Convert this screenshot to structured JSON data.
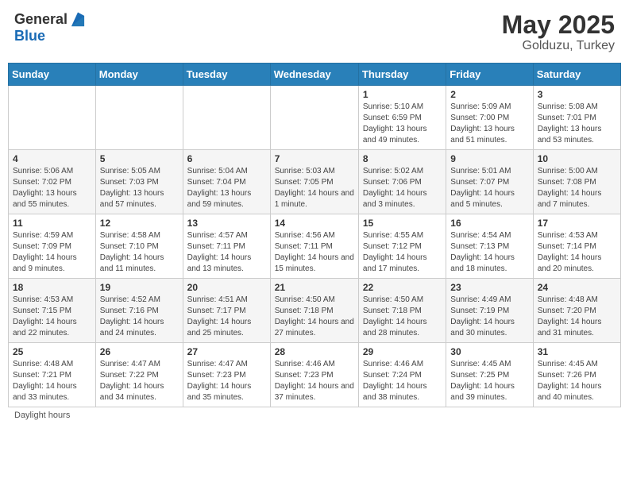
{
  "header": {
    "logo_general": "General",
    "logo_blue": "Blue",
    "month_year": "May 2025",
    "location": "Golduzu, Turkey"
  },
  "columns": [
    "Sunday",
    "Monday",
    "Tuesday",
    "Wednesday",
    "Thursday",
    "Friday",
    "Saturday"
  ],
  "weeks": [
    [
      {
        "day": "",
        "info": ""
      },
      {
        "day": "",
        "info": ""
      },
      {
        "day": "",
        "info": ""
      },
      {
        "day": "",
        "info": ""
      },
      {
        "day": "1",
        "info": "Sunrise: 5:10 AM\nSunset: 6:59 PM\nDaylight: 13 hours and 49 minutes."
      },
      {
        "day": "2",
        "info": "Sunrise: 5:09 AM\nSunset: 7:00 PM\nDaylight: 13 hours and 51 minutes."
      },
      {
        "day": "3",
        "info": "Sunrise: 5:08 AM\nSunset: 7:01 PM\nDaylight: 13 hours and 53 minutes."
      }
    ],
    [
      {
        "day": "4",
        "info": "Sunrise: 5:06 AM\nSunset: 7:02 PM\nDaylight: 13 hours and 55 minutes."
      },
      {
        "day": "5",
        "info": "Sunrise: 5:05 AM\nSunset: 7:03 PM\nDaylight: 13 hours and 57 minutes."
      },
      {
        "day": "6",
        "info": "Sunrise: 5:04 AM\nSunset: 7:04 PM\nDaylight: 13 hours and 59 minutes."
      },
      {
        "day": "7",
        "info": "Sunrise: 5:03 AM\nSunset: 7:05 PM\nDaylight: 14 hours and 1 minute."
      },
      {
        "day": "8",
        "info": "Sunrise: 5:02 AM\nSunset: 7:06 PM\nDaylight: 14 hours and 3 minutes."
      },
      {
        "day": "9",
        "info": "Sunrise: 5:01 AM\nSunset: 7:07 PM\nDaylight: 14 hours and 5 minutes."
      },
      {
        "day": "10",
        "info": "Sunrise: 5:00 AM\nSunset: 7:08 PM\nDaylight: 14 hours and 7 minutes."
      }
    ],
    [
      {
        "day": "11",
        "info": "Sunrise: 4:59 AM\nSunset: 7:09 PM\nDaylight: 14 hours and 9 minutes."
      },
      {
        "day": "12",
        "info": "Sunrise: 4:58 AM\nSunset: 7:10 PM\nDaylight: 14 hours and 11 minutes."
      },
      {
        "day": "13",
        "info": "Sunrise: 4:57 AM\nSunset: 7:11 PM\nDaylight: 14 hours and 13 minutes."
      },
      {
        "day": "14",
        "info": "Sunrise: 4:56 AM\nSunset: 7:11 PM\nDaylight: 14 hours and 15 minutes."
      },
      {
        "day": "15",
        "info": "Sunrise: 4:55 AM\nSunset: 7:12 PM\nDaylight: 14 hours and 17 minutes."
      },
      {
        "day": "16",
        "info": "Sunrise: 4:54 AM\nSunset: 7:13 PM\nDaylight: 14 hours and 18 minutes."
      },
      {
        "day": "17",
        "info": "Sunrise: 4:53 AM\nSunset: 7:14 PM\nDaylight: 14 hours and 20 minutes."
      }
    ],
    [
      {
        "day": "18",
        "info": "Sunrise: 4:53 AM\nSunset: 7:15 PM\nDaylight: 14 hours and 22 minutes."
      },
      {
        "day": "19",
        "info": "Sunrise: 4:52 AM\nSunset: 7:16 PM\nDaylight: 14 hours and 24 minutes."
      },
      {
        "day": "20",
        "info": "Sunrise: 4:51 AM\nSunset: 7:17 PM\nDaylight: 14 hours and 25 minutes."
      },
      {
        "day": "21",
        "info": "Sunrise: 4:50 AM\nSunset: 7:18 PM\nDaylight: 14 hours and 27 minutes."
      },
      {
        "day": "22",
        "info": "Sunrise: 4:50 AM\nSunset: 7:18 PM\nDaylight: 14 hours and 28 minutes."
      },
      {
        "day": "23",
        "info": "Sunrise: 4:49 AM\nSunset: 7:19 PM\nDaylight: 14 hours and 30 minutes."
      },
      {
        "day": "24",
        "info": "Sunrise: 4:48 AM\nSunset: 7:20 PM\nDaylight: 14 hours and 31 minutes."
      }
    ],
    [
      {
        "day": "25",
        "info": "Sunrise: 4:48 AM\nSunset: 7:21 PM\nDaylight: 14 hours and 33 minutes."
      },
      {
        "day": "26",
        "info": "Sunrise: 4:47 AM\nSunset: 7:22 PM\nDaylight: 14 hours and 34 minutes."
      },
      {
        "day": "27",
        "info": "Sunrise: 4:47 AM\nSunset: 7:23 PM\nDaylight: 14 hours and 35 minutes."
      },
      {
        "day": "28",
        "info": "Sunrise: 4:46 AM\nSunset: 7:23 PM\nDaylight: 14 hours and 37 minutes."
      },
      {
        "day": "29",
        "info": "Sunrise: 4:46 AM\nSunset: 7:24 PM\nDaylight: 14 hours and 38 minutes."
      },
      {
        "day": "30",
        "info": "Sunrise: 4:45 AM\nSunset: 7:25 PM\nDaylight: 14 hours and 39 minutes."
      },
      {
        "day": "31",
        "info": "Sunrise: 4:45 AM\nSunset: 7:26 PM\nDaylight: 14 hours and 40 minutes."
      }
    ]
  ],
  "footer": {
    "note": "Daylight hours"
  }
}
